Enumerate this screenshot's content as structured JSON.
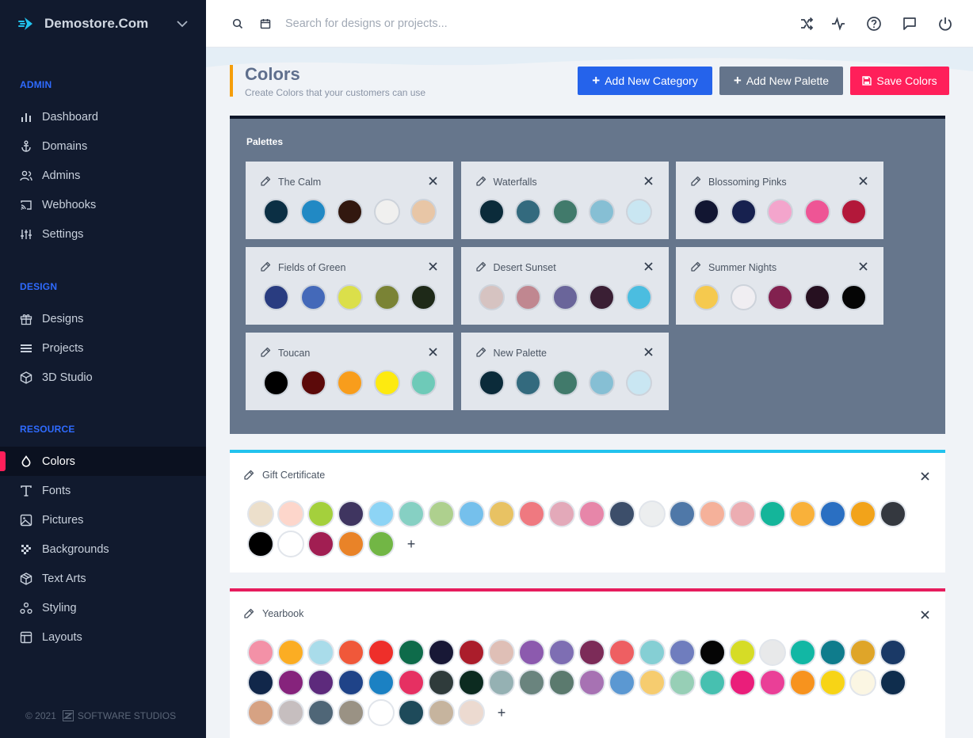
{
  "brand": {
    "name": "Demostore.Com"
  },
  "sidebar": {
    "sections": [
      {
        "title": "ADMIN",
        "items": [
          {
            "label": "Dashboard",
            "icon": "bar-chart-icon"
          },
          {
            "label": "Domains",
            "icon": "anchor-icon"
          },
          {
            "label": "Admins",
            "icon": "users-icon"
          },
          {
            "label": "Webhooks",
            "icon": "cast-icon"
          },
          {
            "label": "Settings",
            "icon": "sliders-icon"
          }
        ]
      },
      {
        "title": "DESIGN",
        "items": [
          {
            "label": "Designs",
            "icon": "gift-icon"
          },
          {
            "label": "Projects",
            "icon": "layers-icon"
          },
          {
            "label": "3D Studio",
            "icon": "cube-icon"
          }
        ]
      },
      {
        "title": "RESOURCE",
        "items": [
          {
            "label": "Colors",
            "icon": "droplet-icon",
            "active": true
          },
          {
            "label": "Fonts",
            "icon": "type-icon"
          },
          {
            "label": "Pictures",
            "icon": "image-icon"
          },
          {
            "label": "Backgrounds",
            "icon": "pattern-icon"
          },
          {
            "label": "Text Arts",
            "icon": "box-icon"
          },
          {
            "label": "Styling",
            "icon": "nodes-icon"
          },
          {
            "label": "Layouts",
            "icon": "layout-icon"
          }
        ]
      }
    ],
    "footer": {
      "year": "© 2021",
      "company": "SOFTWARE STUDIOS"
    }
  },
  "topbar": {
    "search_placeholder": "Search for designs or projects..."
  },
  "page": {
    "title": "Colors",
    "subtitle": "Create Colors that your customers can use",
    "buttons": {
      "add_category": "Add New Category",
      "add_palette": "Add New Palette",
      "save": "Save Colors"
    }
  },
  "palettes": {
    "title": "Palettes",
    "items": [
      {
        "name": "The Calm",
        "colors": [
          "#0b2f44",
          "#2189c4",
          "#32180f",
          "#f0f0ef",
          "#e8c6a6"
        ]
      },
      {
        "name": "Waterfalls",
        "colors": [
          "#0b2b3a",
          "#336a7e",
          "#417a6b",
          "#86bfd4",
          "#c9e6f2"
        ]
      },
      {
        "name": "Blossoming Pinks",
        "colors": [
          "#121632",
          "#17214f",
          "#f3a5cc",
          "#ee5595",
          "#b3183a"
        ]
      },
      {
        "name": "Fields of Green",
        "colors": [
          "#293c80",
          "#4469b9",
          "#dbdf4a",
          "#7a8335",
          "#1e2918"
        ]
      },
      {
        "name": "Desert Sunset",
        "colors": [
          "#d6c3c1",
          "#c08790",
          "#6a659a",
          "#3a1f34",
          "#4bbde0"
        ]
      },
      {
        "name": "Summer Nights",
        "colors": [
          "#f5c94e",
          "#f0eef2",
          "#82214f",
          "#261020",
          "#050505"
        ]
      },
      {
        "name": "Toucan",
        "colors": [
          "#000000",
          "#5c0a0a",
          "#f89d1c",
          "#fdea10",
          "#6ecab8"
        ]
      },
      {
        "name": "New Palette",
        "colors": [
          "#0b2b3a",
          "#336a7e",
          "#417a6b",
          "#86bfd4",
          "#c9e6f2"
        ]
      }
    ]
  },
  "categories": [
    {
      "name": "Gift Certificate",
      "accent": "#22c3ee",
      "colors": [
        "#ecdfcb",
        "#fdd6cb",
        "#a4d03c",
        "#3f3560",
        "#8dd4f5",
        "#86d0c3",
        "#aed08e",
        "#75c0ec",
        "#e8c263",
        "#ef7980",
        "#e3a9b9",
        "#e786a9",
        "#3c4e6a",
        "#eceeef",
        "#4f78a8",
        "#f5b19a",
        "#ecadb2",
        "#14b59a",
        "#f9b13a",
        "#2a6fc2",
        "#f2a31a",
        "#34383f",
        "#000000",
        "#ffffff",
        "#a11e52",
        "#e98328",
        "#72b645"
      ]
    },
    {
      "name": "Yearbook",
      "accent": "#e61c5d",
      "colors": [
        "#f391a7",
        "#fbad23",
        "#a9dcea",
        "#f0583a",
        "#ee2f2a",
        "#0e6b4a",
        "#181836",
        "#ab1d2b",
        "#dfbfb6",
        "#8c5aae",
        "#7e6eb3",
        "#7c2b58",
        "#ee5f62",
        "#85cfd4",
        "#6f7dbe",
        "#050505",
        "#d6dc26",
        "#e8e9ea",
        "#12b7a4",
        "#0f7c8c",
        "#dfa529",
        "#1a3966",
        "#11274a",
        "#86237c",
        "#5d2a7c",
        "#1f4388",
        "#1b81c3",
        "#e63062",
        "#2f3b3b",
        "#0c2b20",
        "#95b1b3",
        "#6a847e",
        "#5b7a6e",
        "#a772b3",
        "#5b98d2",
        "#f6cc6f",
        "#97cfb6",
        "#47c0b0",
        "#ea1e7a",
        "#ea3f97",
        "#f7931e",
        "#f7d416",
        "#fbf6e3",
        "#0f2d4d",
        "#d6a283",
        "#c6bebf",
        "#4f6677",
        "#9a9284",
        "#ffffff",
        "#1e4a5a",
        "#c6b49e",
        "#ecdad0"
      ]
    }
  ]
}
